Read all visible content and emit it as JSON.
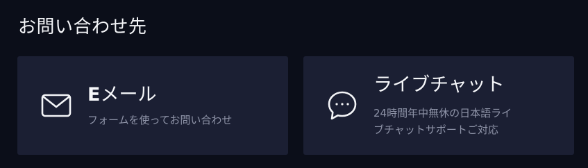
{
  "section": {
    "title": "お問い合わせ先"
  },
  "contacts": {
    "email": {
      "title_prefix": "E",
      "title_rest": "メール",
      "description": "フォームを使ってお問い合わせ",
      "icon": "envelope-icon"
    },
    "chat": {
      "title": "ライブチャット",
      "description_line1": "24時間年中無休の日本語ライ",
      "description_line2": "ブチャットサポートご対応",
      "icon": "chat-bubble-icon"
    }
  },
  "colors": {
    "background": "#0b0e19",
    "card": "#1b1f33",
    "title_text": "#f6f7fa",
    "description_text": "#8e93a7"
  }
}
